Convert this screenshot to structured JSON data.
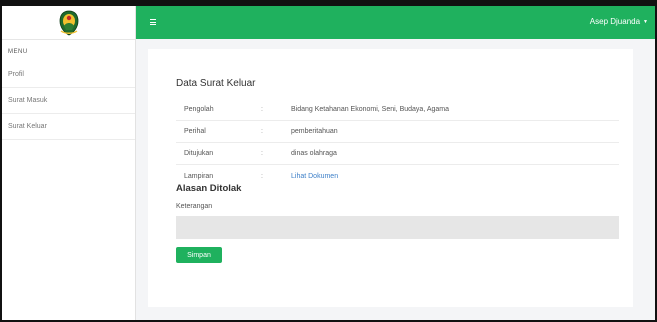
{
  "header": {
    "user_name": "Asep Djuanda",
    "brand_color": "#1fb15e"
  },
  "sidebar": {
    "menu_label": "MENU",
    "items": [
      {
        "label": "Profil"
      },
      {
        "label": "Surat Masuk"
      },
      {
        "label": "Surat Keluar"
      }
    ]
  },
  "main": {
    "title": "Data Surat Keluar",
    "details": [
      {
        "key": "Pengolah",
        "sep": ":",
        "value": "Bidang Ketahanan Ekonomi, Seni, Budaya, Agama"
      },
      {
        "key": "Perihal",
        "sep": ":",
        "value": "pemberitahuan"
      },
      {
        "key": "Ditujukan",
        "sep": ":",
        "value": "dinas olahraga"
      },
      {
        "key": "Lampiran",
        "sep": ":",
        "value": "Lihat Dokumen"
      }
    ],
    "rejection_title": "Alasan Ditolak",
    "keterangan_label": "Keterangan",
    "keterangan_value": "",
    "save_label": "Simpan"
  }
}
